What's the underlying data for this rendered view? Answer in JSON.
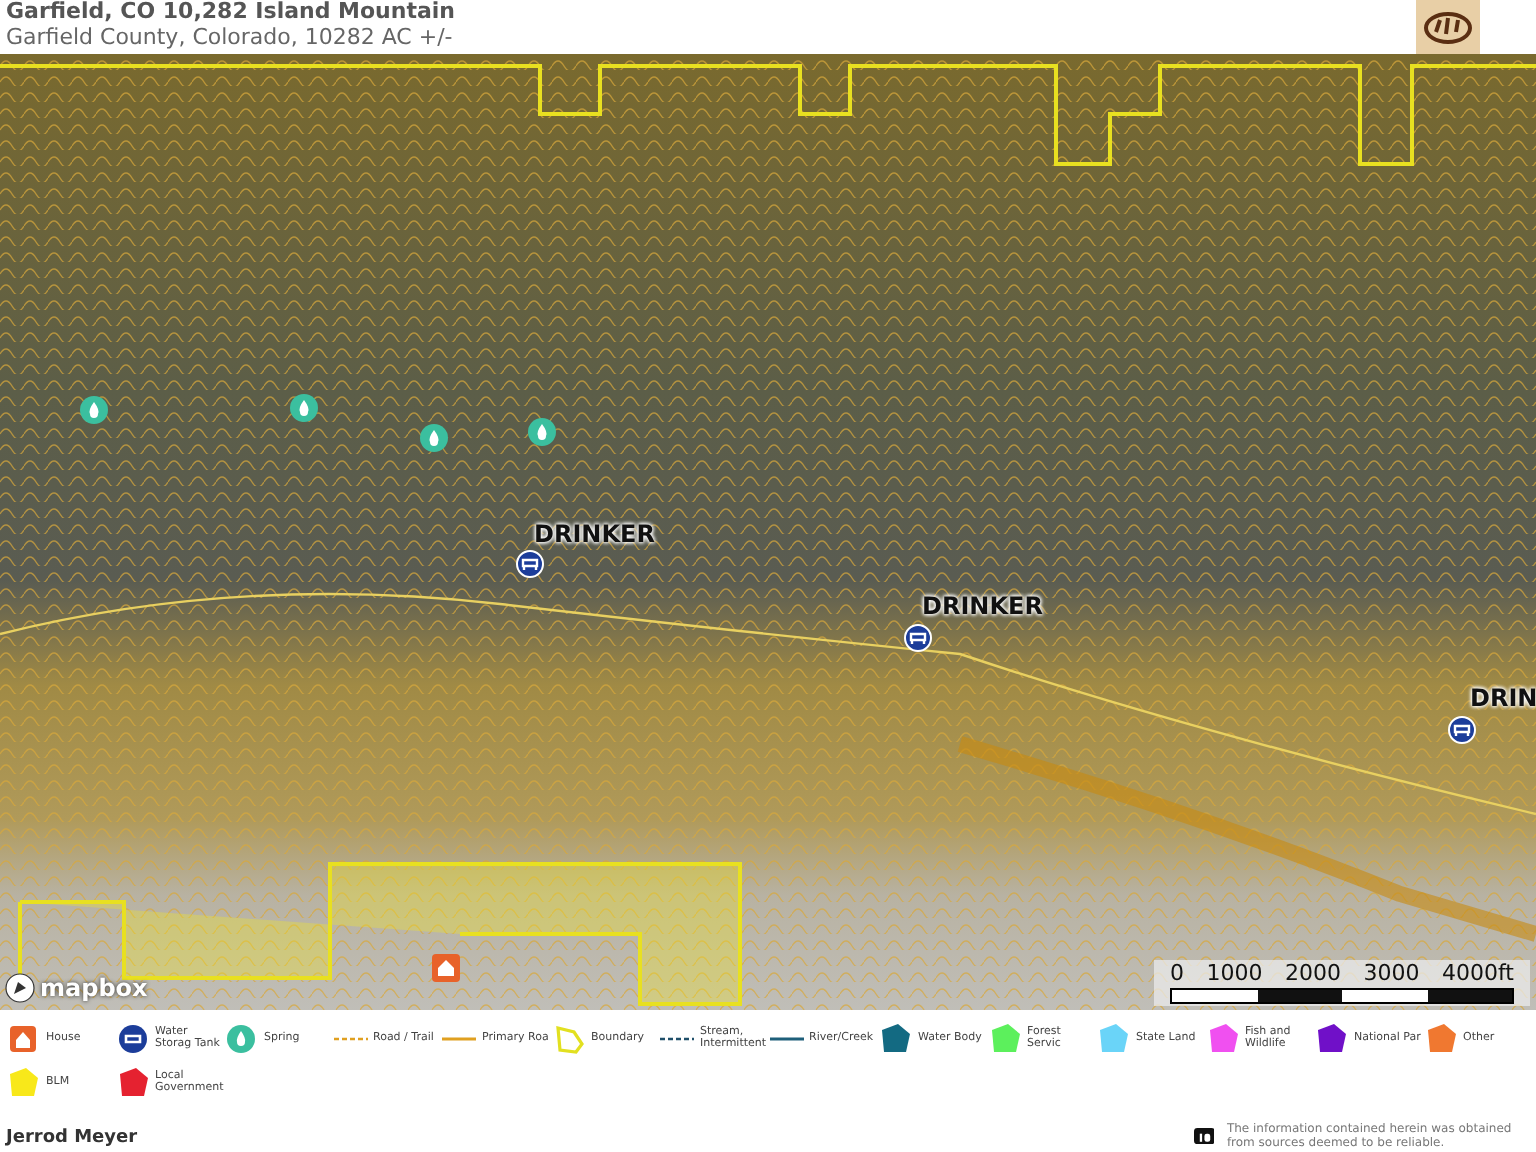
{
  "header": {
    "title": "Garfield, CO 10,282 Island Mountain",
    "subtitle": "Garfield County, Colorado, 10282 AC +/-"
  },
  "map": {
    "markers": [
      {
        "kind": "spring"
      },
      {
        "kind": "spring"
      },
      {
        "kind": "spring"
      },
      {
        "kind": "spring"
      },
      {
        "kind": "water-tank",
        "label": "DRINKER"
      },
      {
        "kind": "water-tank",
        "label": "DRINKER"
      },
      {
        "kind": "water-tank",
        "label": "DRIN"
      },
      {
        "kind": "house"
      }
    ],
    "attribution": "mapbox",
    "scale": {
      "labels": [
        "0",
        "1000",
        "2000",
        "3000",
        "4000ft"
      ]
    }
  },
  "legend": [
    {
      "kind": "house",
      "label": "House",
      "color": "#e8622a"
    },
    {
      "kind": "tank",
      "label": "Water Storag Tank",
      "color": "#1c3d9a"
    },
    {
      "kind": "spring",
      "label": "Spring",
      "color": "#3bbf9f"
    },
    {
      "kind": "dashed",
      "label": "Road / Trail",
      "color": "#e0a020"
    },
    {
      "kind": "line",
      "label": "Primary Roa",
      "color": "#e0a020"
    },
    {
      "kind": "outline",
      "label": "Boundary",
      "color": "#e2e020"
    },
    {
      "kind": "dashed",
      "label": "Stream, Intermittent",
      "color": "#1f4f6a"
    },
    {
      "kind": "line",
      "label": "River/Creek",
      "color": "#1e5f7a"
    },
    {
      "kind": "area",
      "label": "Water Body",
      "color": "#136a82"
    },
    {
      "kind": "area",
      "label": "Forest Servic",
      "color": "#5cf05c"
    },
    {
      "kind": "area",
      "label": "State Land",
      "color": "#6ad4f8"
    },
    {
      "kind": "area",
      "label": "Fish and Wildlife",
      "color": "#f050f0"
    },
    {
      "kind": "area",
      "label": "National Par",
      "color": "#7010c8"
    },
    {
      "kind": "area",
      "label": "Other",
      "color": "#f07830"
    },
    {
      "kind": "area",
      "label": "BLM",
      "color": "#f8e81a"
    },
    {
      "kind": "area",
      "label": "Local Government",
      "color": "#e52230"
    }
  ],
  "footer": {
    "author": "Jerrod Meyer",
    "disclaimer": "The information contained herein was obtained from sources deemed to be reliable."
  }
}
